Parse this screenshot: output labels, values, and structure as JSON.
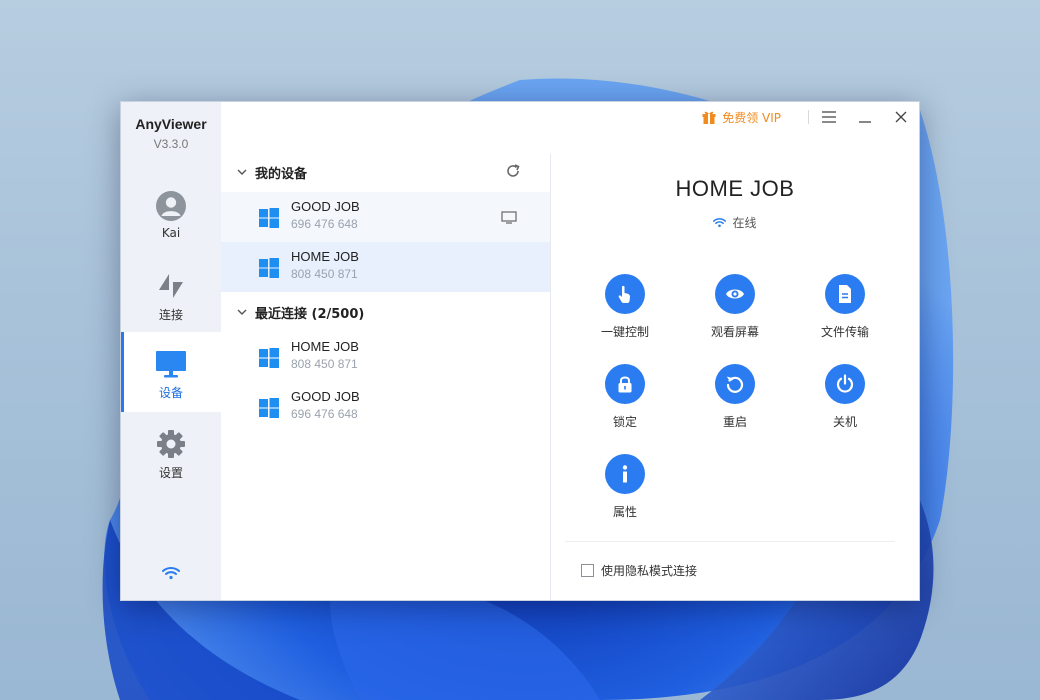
{
  "app": {
    "name": "AnyViewer",
    "version": "V3.3.0"
  },
  "sidebar": {
    "items": [
      {
        "label": "Kai",
        "icon": "avatar-icon"
      },
      {
        "label": "连接",
        "icon": "connect-icon"
      },
      {
        "label": "设备",
        "icon": "monitor-icon",
        "active": true
      },
      {
        "label": "设置",
        "icon": "gear-icon"
      }
    ]
  },
  "titlebar": {
    "vip_label": "免费领 VIP"
  },
  "my_devices": {
    "title": "我的设备",
    "items": [
      {
        "name": "GOOD JOB",
        "id": "696 476 648"
      },
      {
        "name": "HOME JOB",
        "id": "808 450 871"
      }
    ]
  },
  "recent": {
    "title": "最近连接 (2/500)",
    "items": [
      {
        "name": "HOME JOB",
        "id": "808 450 871"
      },
      {
        "name": "GOOD JOB",
        "id": "696 476 648"
      }
    ]
  },
  "detail": {
    "title": "HOME JOB",
    "status": "在线",
    "actions": [
      {
        "label": "一键控制",
        "icon": "hand-pointer-icon"
      },
      {
        "label": "观看屏幕",
        "icon": "eye-icon"
      },
      {
        "label": "文件传输",
        "icon": "file-icon"
      },
      {
        "label": "锁定",
        "icon": "lock-icon"
      },
      {
        "label": "重启",
        "icon": "restart-icon"
      },
      {
        "label": "关机",
        "icon": "power-icon"
      },
      {
        "label": "属性",
        "icon": "info-icon"
      }
    ],
    "privacy_label": "使用隐私模式连接"
  },
  "colors": {
    "accent": "#2a7cf0",
    "vip": "#f08b1f",
    "sidebar_bg": "#eef1f7",
    "selected_row": "#e7f0fc"
  }
}
